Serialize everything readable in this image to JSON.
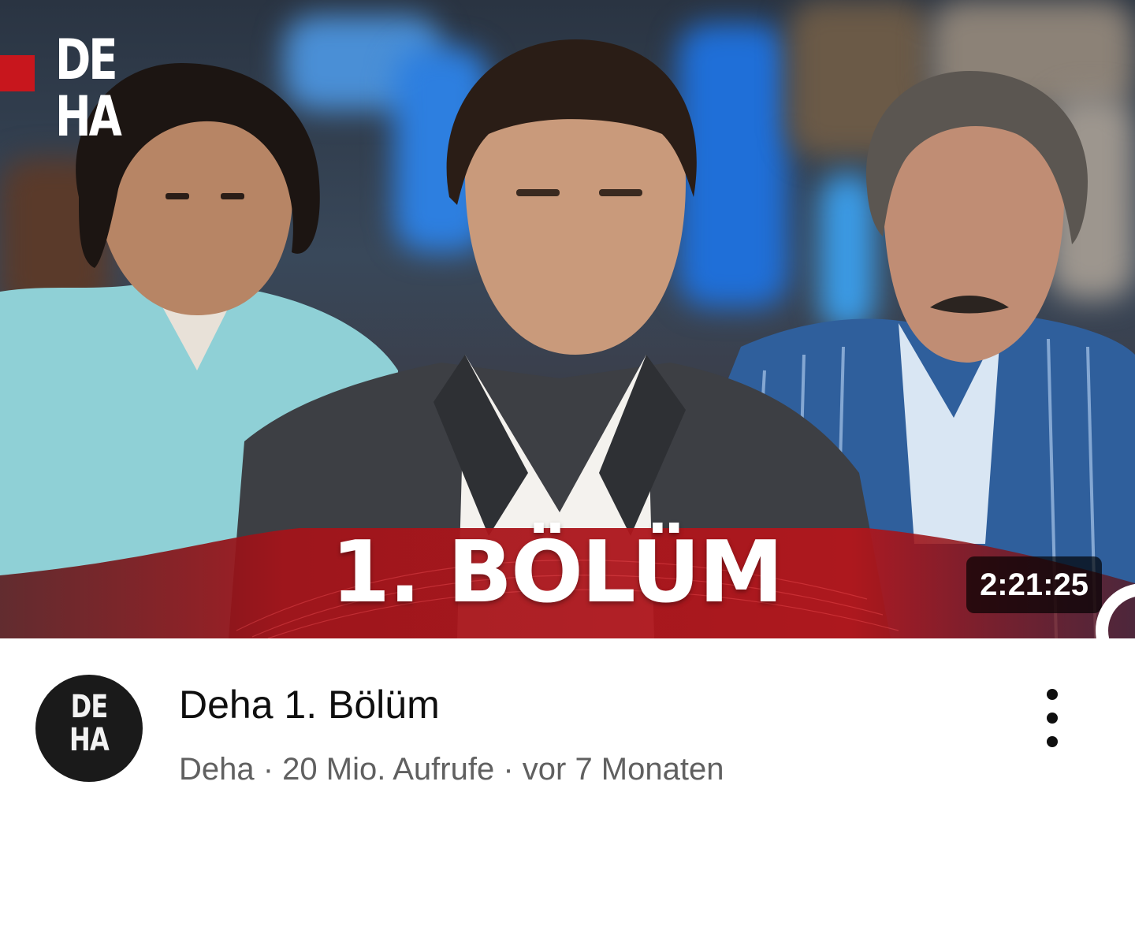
{
  "video": {
    "thumbnail": {
      "logo_text": "DE\nHA",
      "episode_text": "1. BÖLÜM",
      "duration": "2:21:25"
    },
    "channel_avatar": {
      "text": "DE\nHA"
    },
    "title": "Deha 1. Bölüm",
    "channel": "Deha",
    "views": "20 Mio. Aufrufe",
    "age": "vor 7 Monaten",
    "separator": " · ",
    "more_icon": "more-vertical-icon"
  },
  "colors": {
    "brand_red": "#c8161d",
    "title": "#0f0f0f",
    "secondary": "#606060"
  }
}
